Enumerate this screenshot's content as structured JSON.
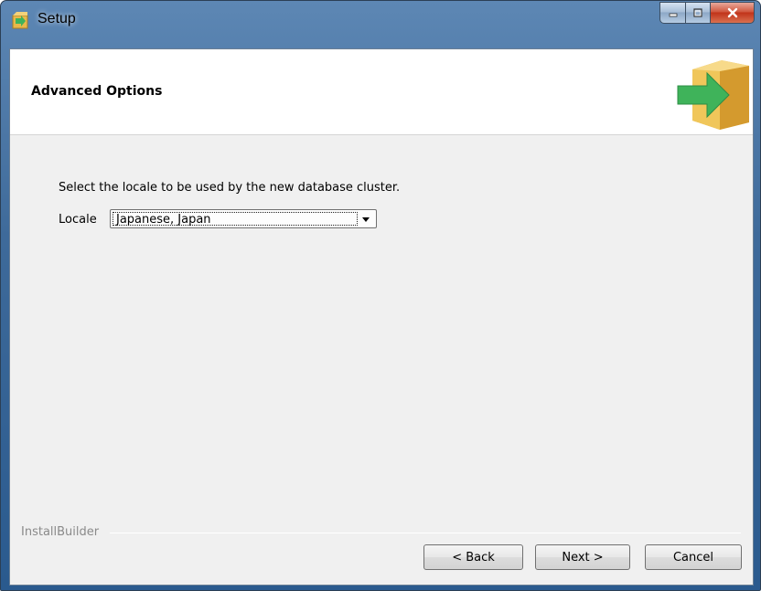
{
  "window": {
    "title": "Setup"
  },
  "header": {
    "title": "Advanced Options"
  },
  "main": {
    "instruction": "Select the locale to be used by the new database cluster.",
    "locale_label": "Locale",
    "locale_value": "Japanese, Japan"
  },
  "footer": {
    "brand": "InstallBuilder",
    "back_label": "< Back",
    "next_label": "Next >",
    "cancel_label": "Cancel"
  },
  "icons": {
    "app": "setup-box-icon",
    "header": "install-box-arrow-icon",
    "minimize": "minimize-icon",
    "maximize": "maximize-icon",
    "close": "close-icon",
    "dropdown": "chevron-down-icon"
  },
  "colors": {
    "box_yellow": "#e8b84a",
    "arrow_green": "#3fb35a",
    "close_red": "#c1331a"
  }
}
